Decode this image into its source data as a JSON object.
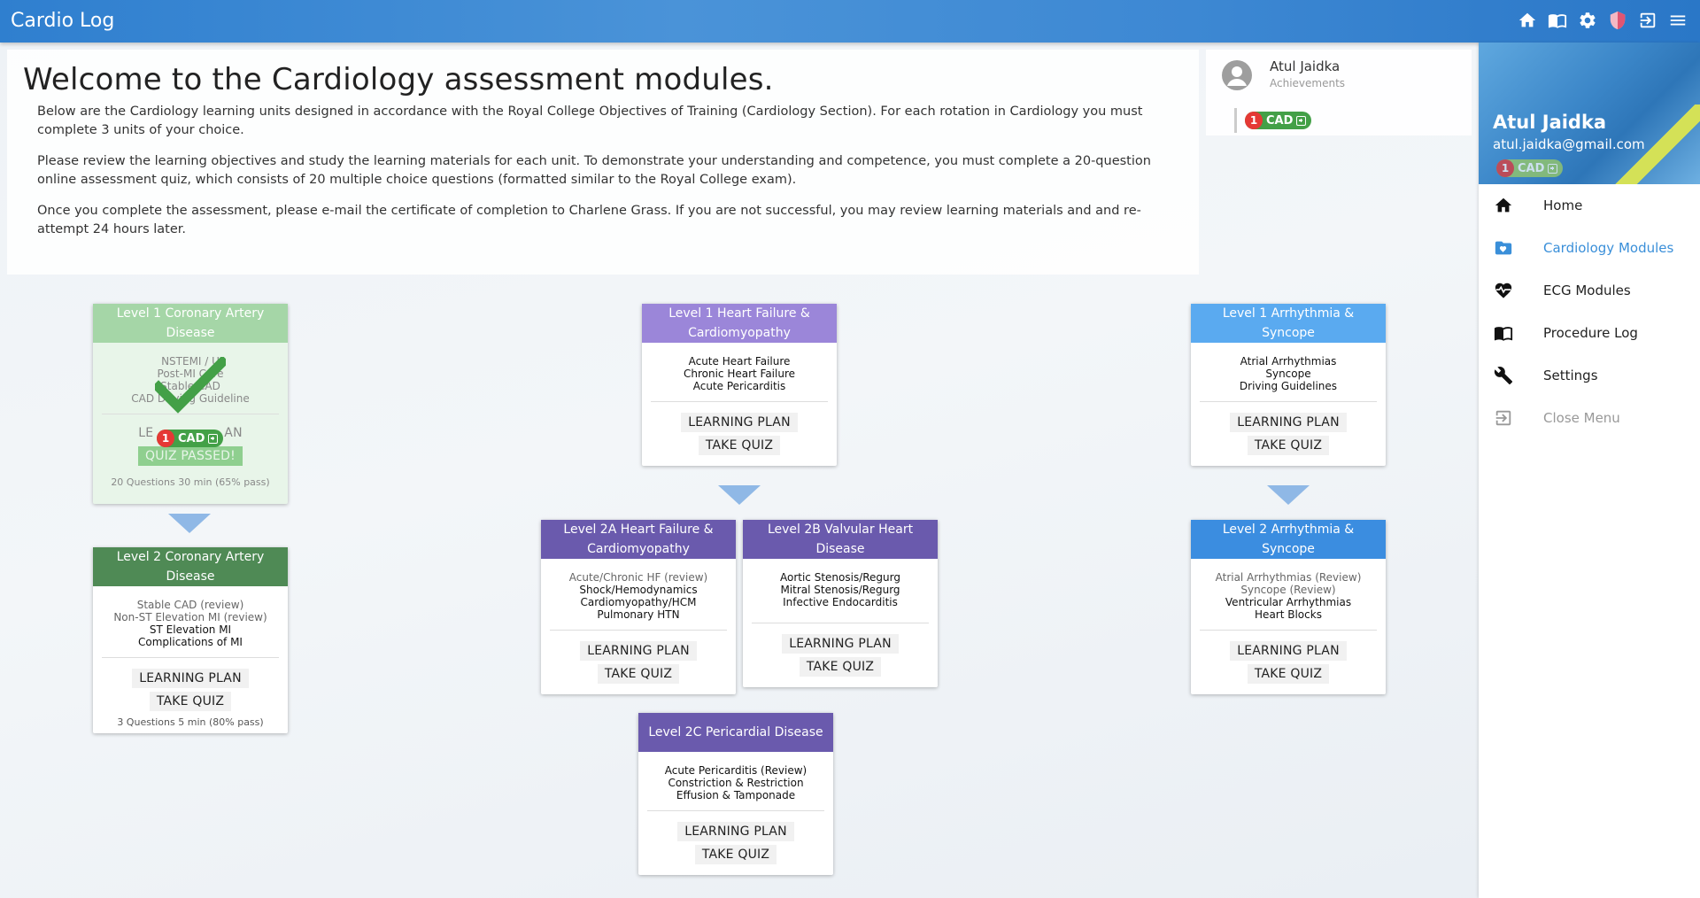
{
  "app": {
    "title": "Cardio Log"
  },
  "welcome": {
    "title": "Welcome to the Cardiology assessment modules.",
    "p1": "Below are the Cardiology learning units designed in accordance with the Royal College Objectives of Training (Cardiology Section). For each rotation in Cardiology you must complete 3 units of your choice.",
    "p2": "Please review the learning objectives and study the learning materials for each unit. To demonstrate your understanding and competence, you must complete a 20-question online assessment quiz, which consists of 20 multiple choice questions (formatted similar to the Royal College exam).",
    "p3": "Once you complete the assessment, please e-mail the certificate of completion to Charlene Grass. If you are not successful, you may review learning materials and and re-attempt 24 hours later."
  },
  "achievements": {
    "name": "Atul Jaidka",
    "label": "Achievements",
    "badge": {
      "count": "1",
      "label": "CAD"
    }
  },
  "sidebar": {
    "user_name": "Atul Jaidka",
    "user_email": "atul.jaidka@gmail.com",
    "badge": {
      "count": "1",
      "label": "CAD"
    },
    "items": [
      {
        "label": "Home",
        "icon": "home-icon"
      },
      {
        "label": "Cardiology Modules",
        "icon": "heart-folder-icon"
      },
      {
        "label": "ECG Modules",
        "icon": "heartbeat-icon"
      },
      {
        "label": "Procedure Log",
        "icon": "book-icon"
      },
      {
        "label": "Settings",
        "icon": "wrench-icon"
      },
      {
        "label": "Close Menu",
        "icon": "exit-icon"
      }
    ]
  },
  "colors": {
    "green_light": "#a5d6a7",
    "green_dark": "#4f8a55",
    "purple_light": "#9b86d9",
    "purple_dark": "#6a5aad",
    "blue_light": "#5aaaf0",
    "blue_dark": "#3b8de0"
  },
  "buttons": {
    "learning_plan": "LEARNING PLAN",
    "take_quiz": "TAKE QUIZ",
    "quiz_passed": "QUIZ PASSED!",
    "learning_plan_partial": "LE",
    "learning_plan_partial_end": "AN"
  },
  "cards": {
    "cad1": {
      "title": "Level 1 Coronary Artery Disease",
      "topics": [
        "NSTEMI / U",
        "Post-MI Care",
        "Stable CAD",
        "CAD Driving Guideline"
      ],
      "meta": "20 Questions 30 min (65% pass)",
      "badge": {
        "count": "1",
        "label": "CAD"
      }
    },
    "cad2": {
      "title": "Level 2 Coronary Artery Disease",
      "topics_review": [
        "Stable CAD (review)",
        "Non-ST Elevation MI (review)"
      ],
      "topics": [
        "ST Elevation MI",
        "Complications of MI"
      ],
      "meta": "3 Questions 5 min (80% pass)"
    },
    "hf1": {
      "title": "Level 1 Heart Failure & Cardiomyopathy",
      "topics": [
        "Acute Heart Failure",
        "Chronic Heart Failure",
        "Acute Pericarditis"
      ]
    },
    "hf2a": {
      "title": "Level 2A Heart Failure & Cardiomyopathy",
      "topics_review": [
        "Acute/Chronic HF (review)"
      ],
      "topics": [
        "Shock/Hemodynamics",
        "Cardiomyopathy/HCM",
        "Pulmonary HTN"
      ]
    },
    "vhd2b": {
      "title": "Level 2B Valvular Heart Disease",
      "topics": [
        "Aortic Stenosis/Regurg",
        "Mitral Stenosis/Regurg",
        "Infective Endocarditis"
      ]
    },
    "peri2c": {
      "title": "Level 2C Pericardial Disease",
      "topics": [
        "Acute Pericarditis (Review)",
        "Constriction & Restriction",
        "Effusion & Tamponade"
      ]
    },
    "arr1": {
      "title": "Level 1 Arrhythmia & Syncope",
      "topics": [
        "Atrial Arrhythmias",
        "Syncope",
        "Driving Guidelines"
      ]
    },
    "arr2": {
      "title": "Level 2 Arrhythmia & Syncope",
      "topics_review": [
        "Atrial Arrhythmias (Review)",
        "Syncope (Review)"
      ],
      "topics": [
        "Ventricular Arrhythmias",
        "Heart Blocks"
      ]
    }
  }
}
